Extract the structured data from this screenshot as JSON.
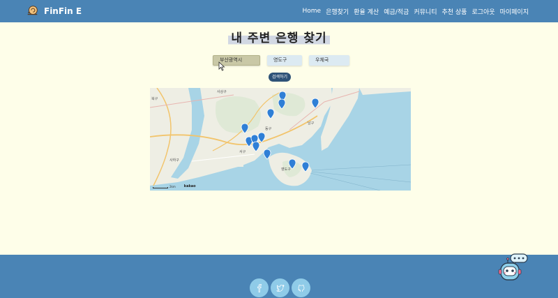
{
  "nav": {
    "brand": "FinFin E",
    "links": [
      "Home",
      "은행찾기",
      "환율 계산",
      "예금/적금",
      "커뮤니티",
      "추천 상품",
      "로그아웃",
      "마이페이지"
    ]
  },
  "page": {
    "title": "내 주변 은행 찾기"
  },
  "filters": {
    "region": "부산광역시",
    "district": "영도구",
    "bank": "우체국",
    "search_label": "검색하기"
  },
  "map": {
    "labels": [
      "사상구",
      "서구",
      "남구",
      "영도구",
      "사하구",
      "동구",
      "북구"
    ],
    "attribution": "kakao",
    "scale": "2km"
  },
  "footer": {
    "icons": [
      "facebook-icon",
      "twitter-icon",
      "github-icon"
    ]
  },
  "colors": {
    "navbar": "#4a84b5",
    "background": "#fefee9",
    "button": "#2e5277",
    "social": "#8fcbe8",
    "marker": "#2f7fd6"
  }
}
